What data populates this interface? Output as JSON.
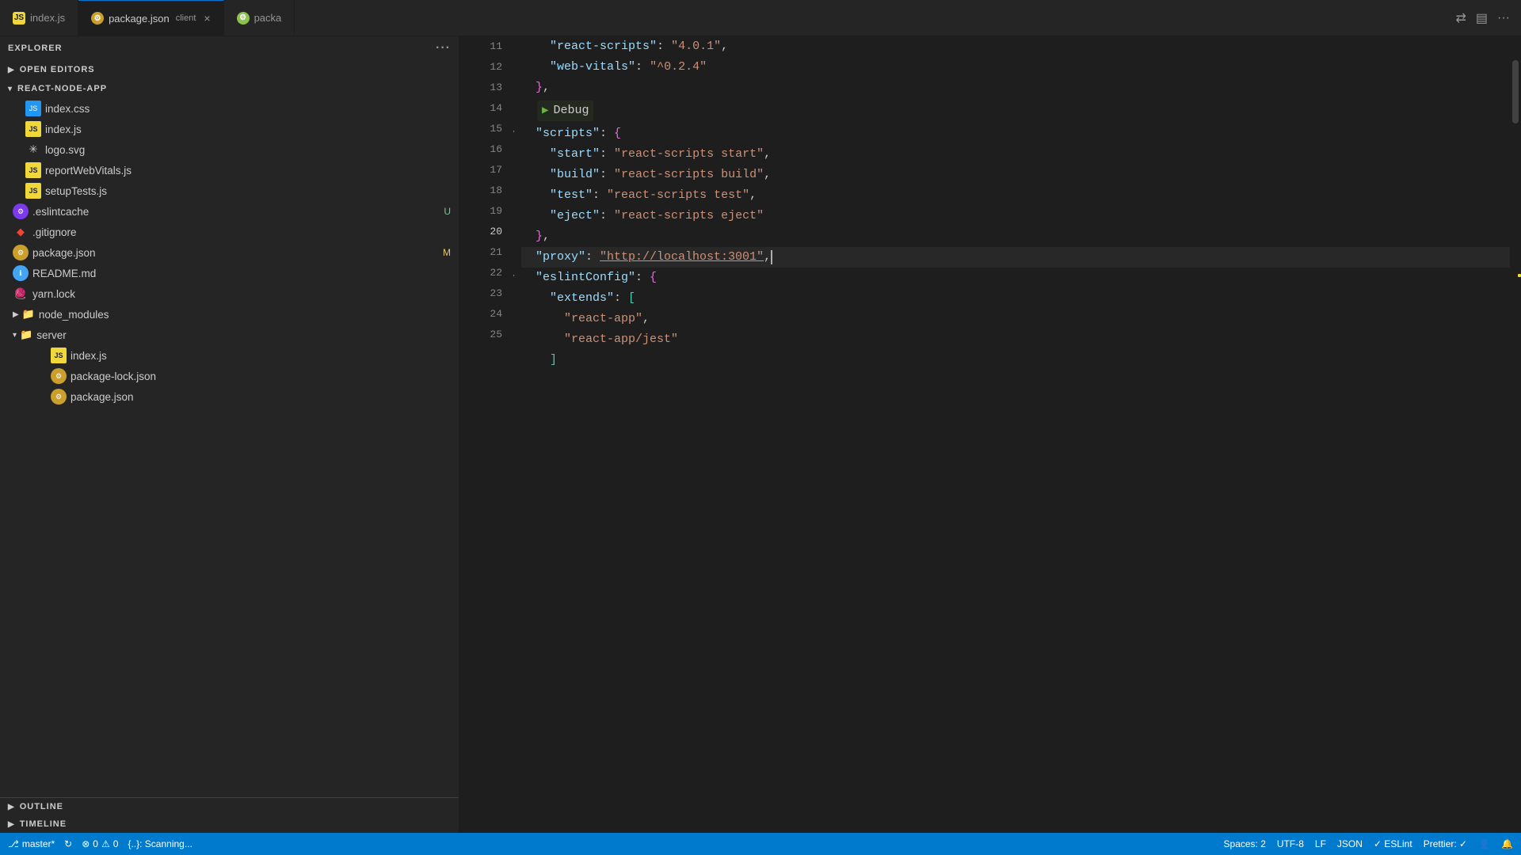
{
  "tabs": [
    {
      "id": "index-js",
      "label": "index.js",
      "icon": "js",
      "active": false,
      "closable": false
    },
    {
      "id": "package-json",
      "label": "package.json",
      "icon": "json",
      "active": true,
      "closable": true,
      "badge": "client"
    },
    {
      "id": "packa",
      "label": "packa",
      "icon": "node",
      "active": false,
      "closable": false
    }
  ],
  "tab_bar_actions": [
    "split-icon",
    "layout-icon",
    "more-icon"
  ],
  "sidebar": {
    "title": "EXPLORER",
    "open_editors_label": "OPEN EDITORS",
    "project_name": "REACT-NODE-APP",
    "files": [
      {
        "name": "index.css",
        "type": "css",
        "indent": 1
      },
      {
        "name": "index.js",
        "type": "js",
        "indent": 1
      },
      {
        "name": "logo.svg",
        "type": "svg",
        "indent": 1
      },
      {
        "name": "reportWebVitals.js",
        "type": "js",
        "indent": 1
      },
      {
        "name": "setupTests.js",
        "type": "js",
        "indent": 1
      },
      {
        "name": ".eslintcache",
        "type": "eslint",
        "indent": 0,
        "badge": "U"
      },
      {
        "name": ".gitignore",
        "type": "git",
        "indent": 0
      },
      {
        "name": "package.json",
        "type": "json",
        "indent": 0,
        "badge": "M"
      },
      {
        "name": "README.md",
        "type": "md",
        "indent": 0
      },
      {
        "name": "yarn.lock",
        "type": "yarn",
        "indent": 0
      }
    ],
    "folders": [
      {
        "name": "node_modules",
        "indent": 0,
        "open": false
      },
      {
        "name": "server",
        "indent": 0,
        "open": true
      }
    ],
    "server_files": [
      {
        "name": "index.js",
        "type": "js",
        "indent": 2
      },
      {
        "name": "package-lock.json",
        "type": "json",
        "indent": 2
      },
      {
        "name": "package.json",
        "type": "json",
        "indent": 2
      }
    ],
    "outline_label": "OUTLINE",
    "timeline_label": "TIMELINE"
  },
  "editor": {
    "lines": [
      {
        "num": 11,
        "content": "react-scripts-line"
      },
      {
        "num": 12,
        "content": "web-vitals-line"
      },
      {
        "num": 13,
        "content": "close-brace-line"
      },
      {
        "num": 14,
        "content": "scripts-key-line",
        "foldable": true
      },
      {
        "num": 15,
        "content": "start-line"
      },
      {
        "num": 16,
        "content": "build-line"
      },
      {
        "num": 17,
        "content": "test-line"
      },
      {
        "num": 18,
        "content": "eject-line"
      },
      {
        "num": 19,
        "content": "close-scripts-line"
      },
      {
        "num": 20,
        "content": "proxy-line",
        "active": true
      },
      {
        "num": 21,
        "content": "eslintconfig-line",
        "foldable": true
      },
      {
        "num": 22,
        "content": "extends-line"
      },
      {
        "num": 23,
        "content": "react-app-line"
      },
      {
        "num": 24,
        "content": "react-app-jest-line"
      },
      {
        "num": 25,
        "content": "close-bracket-line"
      }
    ]
  },
  "status_bar": {
    "branch": "master*",
    "sync_icon": "↻",
    "errors": "0",
    "warnings": "0",
    "scanning": "{..}: Scanning...",
    "spaces": "Spaces: 2",
    "encoding": "UTF-8",
    "line_ending": "LF",
    "language": "JSON",
    "eslint": "✓ ESLint",
    "prettier": "Prettier: ✓",
    "notifications": "🔔"
  }
}
